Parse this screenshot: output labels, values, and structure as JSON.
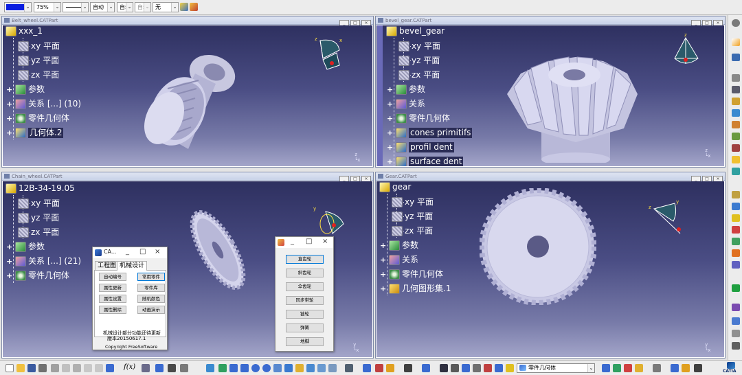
{
  "top_toolbar": {
    "color_label": "",
    "transparency": "75%",
    "linetype": "",
    "thickness": "自动",
    "auto1": "自动",
    "auto2": "自动",
    "layer": "无"
  },
  "windows": {
    "belt": {
      "title": "Belt_wheel.CATPart",
      "tree": [
        "xxx_1",
        "xy 平面",
        "yz 平面",
        "zx 平面",
        "参数",
        "关系 [...] (10)",
        "零件几何体",
        "几何体.2"
      ]
    },
    "bevel": {
      "title": "bevel_gear.CATPart",
      "tree": [
        "bevel_gear",
        "xy 平面",
        "yz 平面",
        "zx 平面",
        "参数",
        "关系",
        "零件几何体",
        "cones primitifs",
        "profil dent",
        "surface dent"
      ]
    },
    "chain": {
      "title": "Chain_wheel.CATPart",
      "tree": [
        "12B-34-19.05",
        "xy 平面",
        "yz 平面",
        "zx 平面",
        "参数",
        "关系 [...] (21)",
        "零件几何体"
      ]
    },
    "gear": {
      "title": "Gear.CATPart",
      "tree": [
        "gear",
        "xy 平面",
        "yz 平面",
        "zx 平面",
        "参数",
        "关系",
        "零件几何体",
        "几何图形集.1"
      ]
    }
  },
  "window_buttons": {
    "min": "_",
    "max": "□",
    "close": "×"
  },
  "dialog_main": {
    "title": "CA...",
    "tabs": [
      "工程图",
      "机械设计"
    ],
    "buttons": [
      "自动编号",
      "常用零件",
      "属性更新",
      "零件库",
      "属性设置",
      "随机颜色",
      "属性删除",
      "动画演示"
    ],
    "note_line1": "机械设计部分功能还待更新",
    "note_line2": "版本20150617.1",
    "copyright": "Copyright FreeSoftware"
  },
  "dialog_parts": {
    "buttons": [
      "直齿轮",
      "斜齿轮",
      "伞齿轮",
      "同步带轮",
      "链轮",
      "弹簧",
      "地脚"
    ]
  },
  "axis": {
    "x": "x",
    "y": "y",
    "z": "z"
  },
  "bottom_toolbar": {
    "formula_label": "f(x)",
    "scope_label": "零件几何体"
  },
  "catia_logo": "CATIA"
}
